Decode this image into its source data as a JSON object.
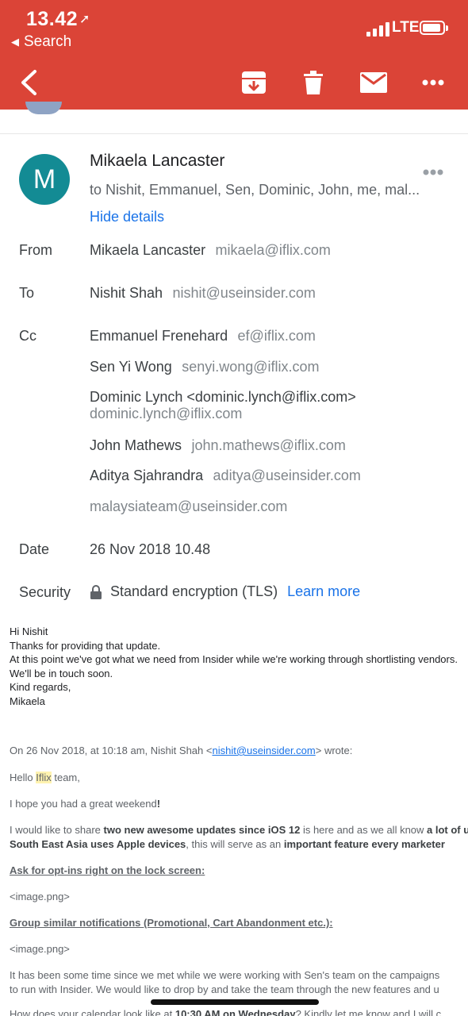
{
  "status_bar": {
    "time": "13.42",
    "back_app": "Search",
    "network": "LTE"
  },
  "toolbar": {
    "back": "back",
    "archive": "archive",
    "delete": "delete",
    "mark_unread": "mark unread",
    "more": "more"
  },
  "message_header": {
    "avatar_letter": "M",
    "sender_name": "Mikaela Lancaster",
    "recipients_summary": "to Nishit, Emmanuel, Sen, Dominic, John, me, mal...",
    "hide_details": "Hide details"
  },
  "details": {
    "from_label": "From",
    "from": {
      "name": "Mikaela Lancaster",
      "email": "mikaela@iflix.com"
    },
    "to_label": "To",
    "to": {
      "name": "Nishit Shah",
      "email": "nishit@useinsider.com"
    },
    "cc_label": "Cc",
    "cc": [
      {
        "name": "Emmanuel Frenehard",
        "email": "ef@iflix.com"
      },
      {
        "name": "Sen Yi Wong",
        "email": "senyi.wong@iflix.com"
      },
      {
        "name": "Dominic Lynch <dominic.lynch@iflix.com>",
        "email": "dominic.lynch@iflix.com"
      },
      {
        "name": "John Mathews",
        "email": "john.mathews@iflix.com"
      },
      {
        "name": "Aditya Sjahrandra",
        "email": "aditya@useinsider.com"
      },
      {
        "name": "",
        "email": "malaysiateam@useinsider.com"
      }
    ],
    "date_label": "Date",
    "date": "26 Nov 2018 10.48",
    "security_label": "Security",
    "security": "Standard encryption (TLS)",
    "learn_more": "Learn more"
  },
  "body": {
    "lines": [
      "Hi Nishit",
      "Thanks for providing that update.",
      "At this point we've got what we need from Insider while we're working through shortlisting vendors.",
      "We'll be in touch soon.",
      "Kind regards,",
      "Mikaela"
    ]
  },
  "quoted": {
    "header_prefix": "On 26 Nov 2018, at 10:18 am, Nishit Shah <",
    "header_link": "nishit@useinsider.com",
    "header_suffix": "> wrote:",
    "greeting_prefix": "Hello ",
    "greeting_highlight": "Iflix",
    "greeting_suffix": " team,",
    "weekend": "I hope you had a great weekend",
    "weekend_bang": "!",
    "share_1a": "I would like to share ",
    "share_1b": "two new awesome updates since iOS 12",
    "share_1c": " is here and as we all know ",
    "share_1d": "a lot of users in",
    "share_2a": "South East Asia uses Apple devices",
    "share_2b": ", this will serve as an ",
    "share_2c": "important feature every marketer",
    "optin": "Ask for opt-ins right on the lock screen:",
    "image1": "<image.png>",
    "group": "Group similar notifications (Promotional, Cart Abandonment etc.):",
    "image2": "<image.png>",
    "since_1": "It has been some time since we met while we were working with Sen's team on the campaigns",
    "since_2": "to run with Insider. We would like to drop by and take the team through the new features and u",
    "calendar_a": "How does your calendar look like at ",
    "calendar_b": "10:30 AM on Wednesday",
    "calendar_c": "? Kindly let me know and I will c"
  }
}
